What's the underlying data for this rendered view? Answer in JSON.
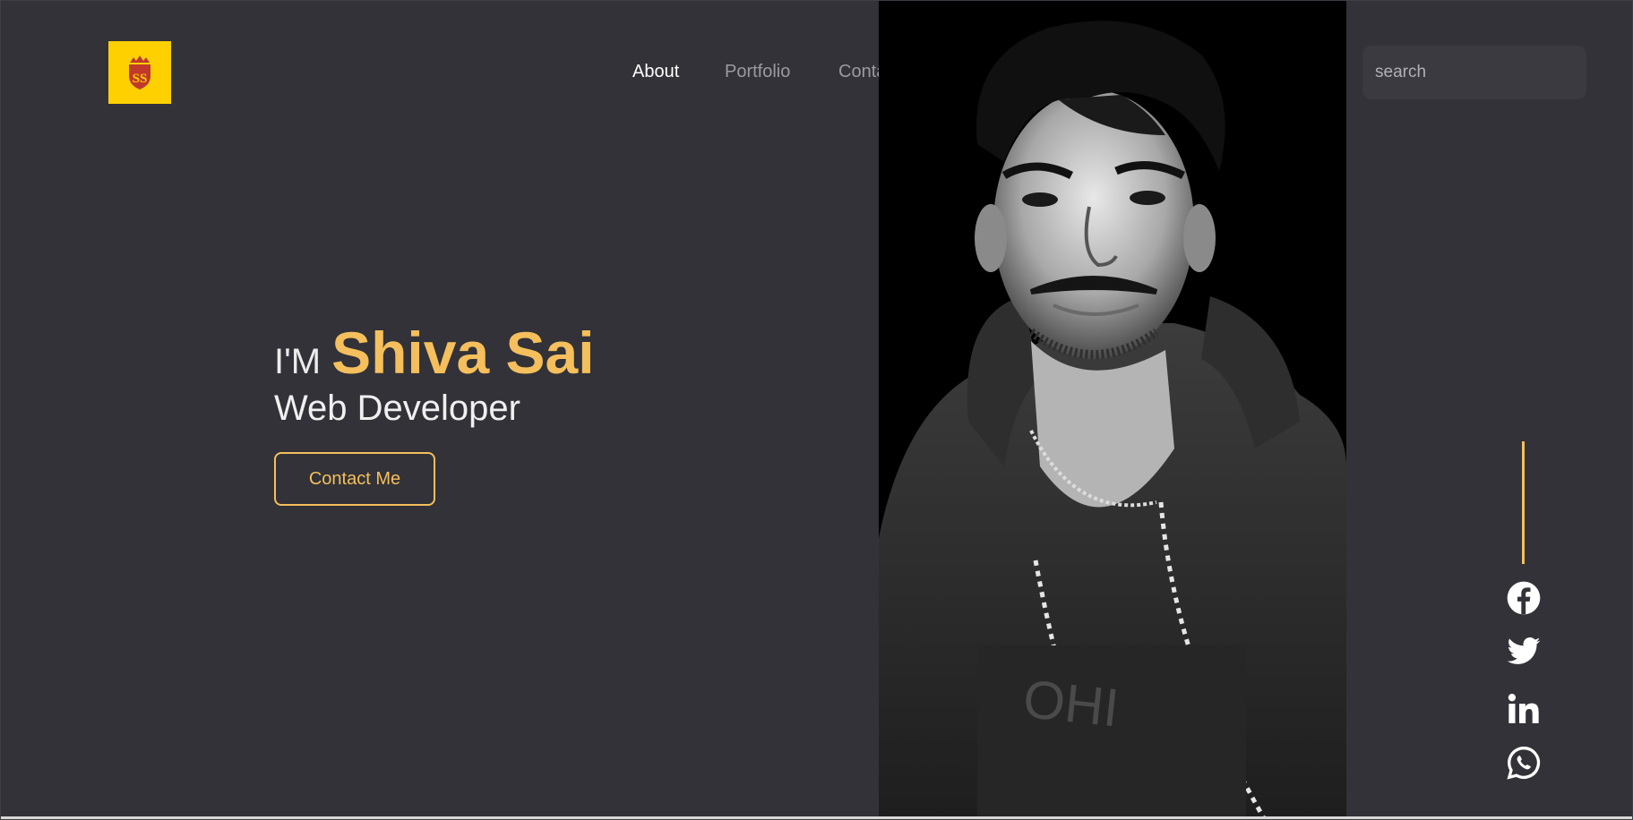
{
  "logo": {
    "monogram": "SS",
    "background": "#ffd000",
    "accent": "#c0392b",
    "icon": "crown-shield-logo"
  },
  "nav": {
    "items": [
      {
        "label": "About",
        "active": true
      },
      {
        "label": "Portfolio",
        "active": false
      },
      {
        "label": "Contact",
        "active": false
      }
    ]
  },
  "search": {
    "placeholder": "search",
    "icon": "search-icon"
  },
  "hero": {
    "greeting": "I'M",
    "name": "Shiva Sai",
    "role": "Web Developer",
    "cta_label": "Contact Me"
  },
  "photo": {
    "icon": "portrait-photo",
    "style": "black-and-white"
  },
  "social": [
    {
      "name": "facebook",
      "icon": "facebook-icon"
    },
    {
      "name": "twitter",
      "icon": "twitter-icon"
    },
    {
      "name": "linkedin",
      "icon": "linkedin-icon"
    },
    {
      "name": "whatsapp",
      "icon": "whatsapp-icon"
    }
  ],
  "colors": {
    "background": "#323238",
    "accent": "#f4bf5c",
    "text": "#ffffff",
    "muted": "#9a9aa0"
  }
}
